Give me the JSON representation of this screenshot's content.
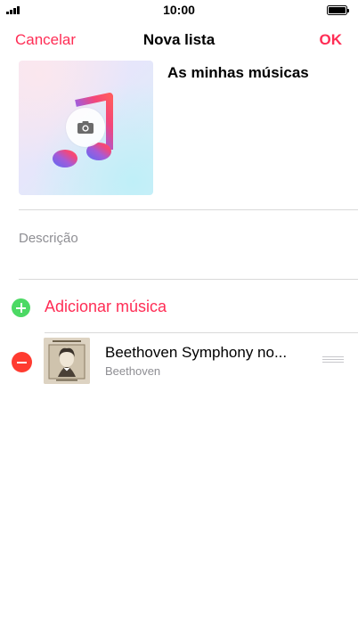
{
  "status_bar": {
    "time": "10:00"
  },
  "nav": {
    "cancel_label": "Cancelar",
    "title": "Nova lista",
    "done_label": "OK"
  },
  "playlist": {
    "name": "As minhas músicas",
    "description_placeholder": "Descrição",
    "artwork_icon": "music-note-icon",
    "camera_icon": "camera-icon"
  },
  "add_song": {
    "label": "Adicionar música",
    "icon": "plus-circle-icon"
  },
  "songs": [
    {
      "title": "Beethoven Symphony no...",
      "artist": "Beethoven",
      "remove_icon": "minus-circle-icon",
      "reorder_icon": "reorder-handle-icon"
    }
  ],
  "colors": {
    "accent": "#ff2d55",
    "add": "#4cd964",
    "remove": "#ff3b30",
    "secondary_text": "#8e8e93"
  }
}
